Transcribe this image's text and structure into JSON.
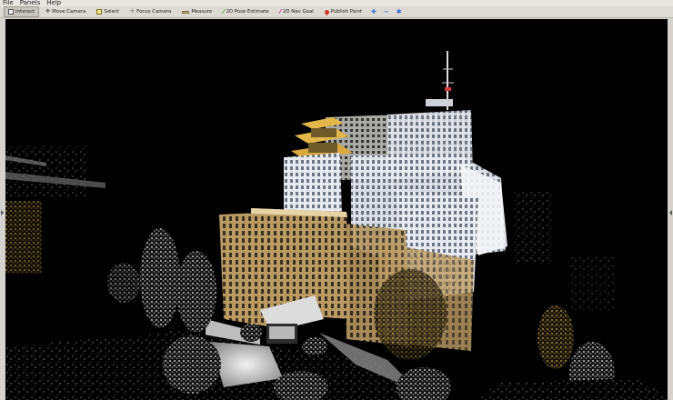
{
  "menu": {
    "file": "File",
    "panels": "Panels",
    "help": "Help"
  },
  "toolbar": {
    "interact": "Interact",
    "move_camera": "Move Camera",
    "select": "Select",
    "focus_camera": "Focus Camera",
    "measure": "Measure",
    "pose_estimate": "2D Pose Estimate",
    "nav_goal": "2D Nav Goal",
    "publish_point": "Publish Point"
  },
  "icons": {
    "interact": "cursor-icon",
    "move_camera": "move-camera-icon",
    "select": "select-box-icon",
    "focus_camera": "focus-camera-icon",
    "measure": "ruler-icon",
    "pose_estimate": "green-arrow-icon",
    "nav_goal": "pink-arrow-icon",
    "publish_point": "map-pin-icon",
    "add": "plus-icon",
    "remove": "minus-icon",
    "camera": "camera-options-icon"
  },
  "colors": {
    "viewport_background": "#000000",
    "pagoda": "#e3b64a",
    "building_warm": "#c9a86f",
    "building_cool": "#e8ecf2"
  }
}
